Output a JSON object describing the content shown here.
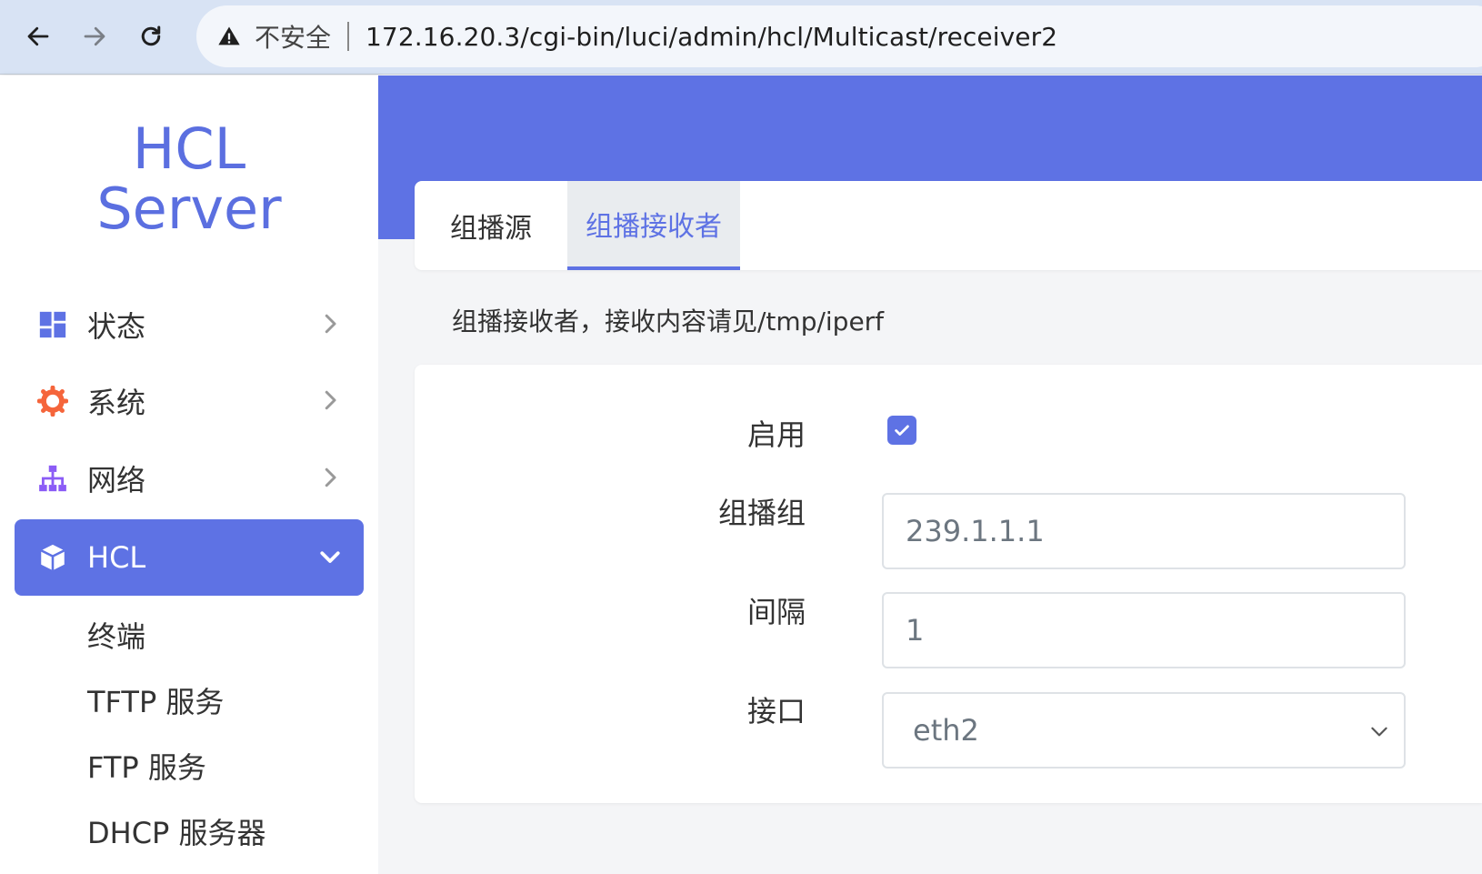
{
  "browser": {
    "insecure_label": "不安全",
    "url": "172.16.20.3/cgi-bin/luci/admin/hcl/Multicast/receiver2"
  },
  "sidebar": {
    "brand_line1": "HCL",
    "brand_line2": "Server",
    "items": [
      {
        "label": "状态",
        "icon": "dashboard-icon"
      },
      {
        "label": "系统",
        "icon": "gear-icon"
      },
      {
        "label": "网络",
        "icon": "network-icon"
      },
      {
        "label": "HCL",
        "icon": "cube-icon"
      }
    ],
    "subitems": [
      "终端",
      "TFTP 服务",
      "FTP 服务",
      "DHCP 服务器"
    ]
  },
  "tabs": [
    {
      "label": "组播源"
    },
    {
      "label": "组播接收者"
    }
  ],
  "description": "组播接收者，接收内容请见/tmp/iperf",
  "form": {
    "enable_label": "启用",
    "enable_checked": true,
    "group_label": "组播组",
    "group_value": "239.1.1.1",
    "interval_label": "间隔",
    "interval_value": "1",
    "interface_label": "接口",
    "interface_value": "eth2"
  },
  "colors": {
    "accent": "#5e72e4",
    "gear": "#f5653b",
    "network": "#8b5cf6"
  }
}
